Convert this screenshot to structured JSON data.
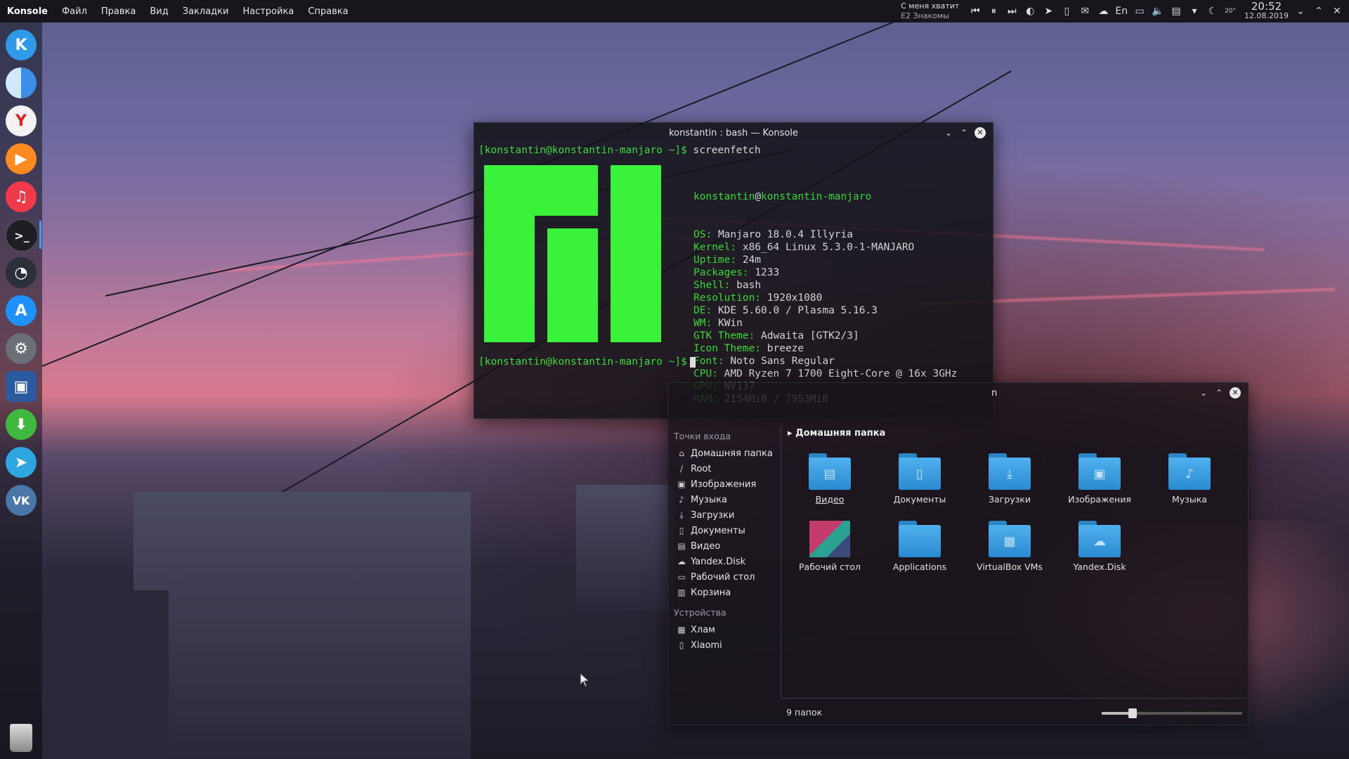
{
  "topbar": {
    "app_name": "Konsole",
    "menu": [
      "Файл",
      "Правка",
      "Вид",
      "Закладки",
      "Настройка",
      "Справка"
    ],
    "now_playing": {
      "title": "С меня хватит",
      "artist": "Е2 Знакомы"
    },
    "tray_icons": [
      "previous-icon",
      "pause-icon",
      "next-icon",
      "palette-icon",
      "telegram-icon",
      "usb-icon",
      "mail-icon",
      "cloud-icon"
    ],
    "layout": "En",
    "weather_temp": "20°",
    "time": "20:52",
    "date": "12.08.2019"
  },
  "dock": {
    "items": [
      "kde-icon",
      "finder-icon",
      "yandex-browser-icon",
      "player-icon",
      "music-icon",
      "terminal-icon",
      "speedometer-icon",
      "appstore-icon",
      "settings-icon",
      "screenshot-icon",
      "download-icon",
      "telegram-icon",
      "vk-icon"
    ],
    "active_index": 5,
    "vk_label": "VK",
    "yandex_label": "Y"
  },
  "konsole": {
    "title": "konstantin : bash — Konsole",
    "prompt": "[konstantin@konstantin-manjaro ~]$",
    "command": "screenfetch",
    "user": "konstantin",
    "at": "@",
    "host": "konstantin-manjaro",
    "info": [
      {
        "key": "OS:",
        "value": "Manjaro 18.0.4 Illyria"
      },
      {
        "key": "Kernel:",
        "value": "x86_64 Linux 5.3.0-1-MANJARO"
      },
      {
        "key": "Uptime:",
        "value": "24m"
      },
      {
        "key": "Packages:",
        "value": "1233"
      },
      {
        "key": "Shell:",
        "value": "bash"
      },
      {
        "key": "Resolution:",
        "value": "1920x1080"
      },
      {
        "key": "DE:",
        "value": "KDE 5.60.0 / Plasma 5.16.3"
      },
      {
        "key": "WM:",
        "value": "KWin"
      },
      {
        "key": "GTK Theme:",
        "value": "Adwaita [GTK2/3]"
      },
      {
        "key": "Icon Theme:",
        "value": "breeze"
      },
      {
        "key": "Font:",
        "value": "Noto Sans Regular"
      },
      {
        "key": "CPU:",
        "value": "AMD Ryzen 7 1700 Eight-Core @ 16x 3GHz"
      },
      {
        "key": "GPU:",
        "value": "NV137"
      },
      {
        "key": "RAM:",
        "value": "2154MiB / 7953MiB"
      }
    ],
    "logo_color": "#3af23a"
  },
  "dolphin": {
    "title_fragment": "n",
    "places_header": "Точки входа",
    "places": [
      {
        "label": "Домашняя папка",
        "icon": "home-icon"
      },
      {
        "label": "Root",
        "icon": "root-icon"
      },
      {
        "label": "Изображения",
        "icon": "image-icon"
      },
      {
        "label": "Музыка",
        "icon": "music-note-icon"
      },
      {
        "label": "Загрузки",
        "icon": "download-icon"
      },
      {
        "label": "Документы",
        "icon": "document-icon"
      },
      {
        "label": "Видео",
        "icon": "film-icon"
      },
      {
        "label": "Yandex.Disk",
        "icon": "cloud-icon"
      },
      {
        "label": "Рабочий стол",
        "icon": "desktop-icon"
      },
      {
        "label": "Корзина",
        "icon": "trash-icon"
      }
    ],
    "devices_header": "Устройства",
    "devices": [
      {
        "label": "Хлам",
        "icon": "drive-icon"
      },
      {
        "label": "Xiaomi",
        "icon": "phone-icon"
      }
    ],
    "breadcrumb": "Домашняя папка",
    "files": [
      {
        "label": "Видео",
        "icon": "film-icon"
      },
      {
        "label": "Документы",
        "icon": "document-icon"
      },
      {
        "label": "Загрузки",
        "icon": "download-icon"
      },
      {
        "label": "Изображения",
        "icon": "image-icon"
      },
      {
        "label": "Музыка",
        "icon": "music-note-icon"
      },
      {
        "label": "Рабочий стол",
        "icon": "desktop-icon"
      },
      {
        "label": "Applications",
        "icon": "folder-icon"
      },
      {
        "label": "VirtualBox VMs",
        "icon": "virtualbox-icon"
      },
      {
        "label": "Yandex.Disk",
        "icon": "cloud-icon"
      }
    ],
    "status": "9 папок",
    "zoom_level": 0.22
  },
  "colors": {
    "accent": "#3fa0ff",
    "folder": "#3a9de0",
    "prompt": "#3ddc3d"
  }
}
